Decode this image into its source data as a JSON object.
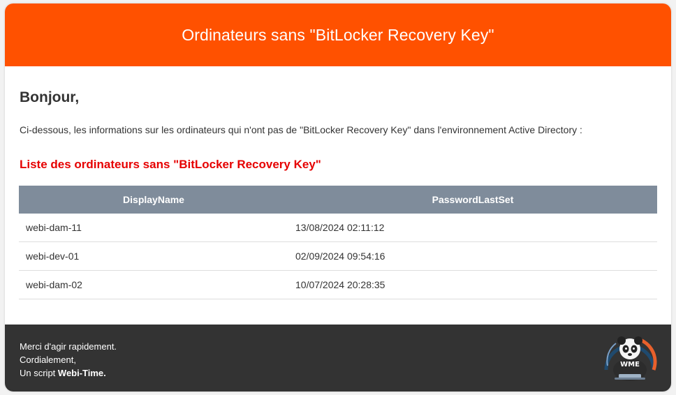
{
  "header": {
    "title": "Ordinateurs sans \"BitLocker Recovery Key\""
  },
  "content": {
    "greeting": "Bonjour,",
    "intro": "Ci-dessous, les informations sur les ordinateurs qui n'ont pas de \"BitLocker Recovery Key\" dans l'environnement Active Directory :",
    "list_title": "Liste des ordinateurs sans \"BitLocker Recovery Key\""
  },
  "table": {
    "columns": [
      "DisplayName",
      "PasswordLastSet"
    ],
    "rows": [
      [
        "webi-dam-11",
        "13/08/2024 02:11:12"
      ],
      [
        "webi-dev-01",
        "02/09/2024 09:54:16"
      ],
      [
        "webi-dam-02",
        "10/07/2024 20:28:35"
      ]
    ]
  },
  "footer": {
    "line1": "Merci d'agir rapidement.",
    "line2": "Cordialement,",
    "line3_prefix": "Un script ",
    "line3_brand": "Webi-Time.",
    "logo_text": "WME"
  },
  "colors": {
    "header_bg": "#ff5100",
    "list_title": "#e60000",
    "table_header_bg": "#7f8c9b",
    "footer_bg": "#333333"
  },
  "icons": {
    "logo": "panda-mascot-logo"
  }
}
